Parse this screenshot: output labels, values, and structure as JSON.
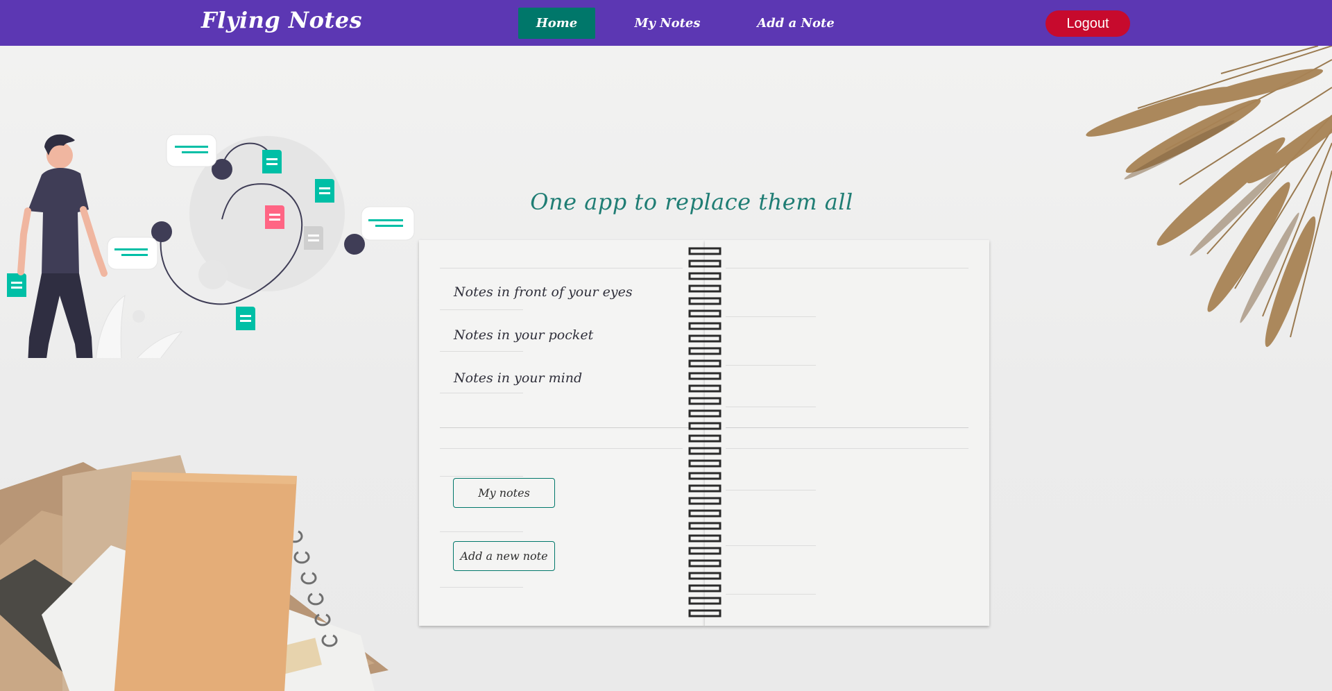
{
  "navbar": {
    "brand": "Flying Notes",
    "links": [
      {
        "label": "Home",
        "active": true
      },
      {
        "label": "My Notes",
        "active": false
      },
      {
        "label": "Add a Note",
        "active": false
      }
    ],
    "logout_label": "Logout"
  },
  "hero": {
    "headline": "One app to replace them all",
    "taglines": [
      "Notes in front of your eyes",
      "Notes in your pocket",
      "Notes in your mind"
    ],
    "buttons": {
      "my_notes": "My notes",
      "add_note": "Add a new note"
    }
  },
  "colors": {
    "navbar": "#5c37b3",
    "active_link": "#00776a",
    "logout": "#c70a2d",
    "accent": "#1f7d74",
    "illustration_teal": "#00bfa6",
    "illustration_pink": "#ff6584"
  },
  "icons": [
    "person-illustration",
    "note-icon",
    "chat-bubble-icon",
    "wheat-decoration",
    "notebook-stack"
  ]
}
